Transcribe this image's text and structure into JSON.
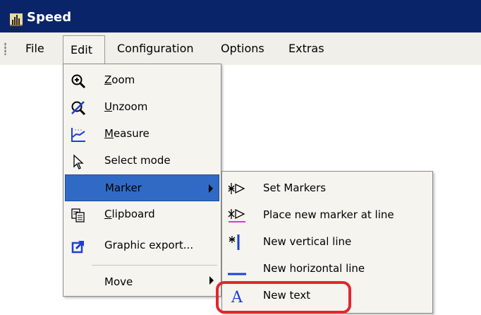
{
  "window": {
    "title": "Speed"
  },
  "menubar": {
    "items": [
      {
        "label": "File"
      },
      {
        "label": "Edit"
      },
      {
        "label": "Configuration"
      },
      {
        "label": "Options"
      },
      {
        "label": "Extras"
      }
    ]
  },
  "edit_menu": {
    "items": [
      {
        "mnemonic": "Z",
        "rest": "oom",
        "icon": "zoom-in-icon"
      },
      {
        "mnemonic": "U",
        "rest": "nzoom",
        "icon": "unzoom-icon"
      },
      {
        "mnemonic": "M",
        "rest": "easure",
        "icon": "measure-icon"
      },
      {
        "label": "Select mode",
        "icon": "cursor-arrow-icon"
      },
      {
        "label": "Marker",
        "has_submenu": true
      },
      {
        "mnemonic": "C",
        "rest": "lipboard",
        "icon": "clipboard-icon"
      },
      {
        "label": "Graphic export...",
        "icon": "export-icon"
      },
      {
        "label": "Move",
        "has_submenu": true
      }
    ]
  },
  "marker_submenu": {
    "items": [
      {
        "label": "Set Markers",
        "icon": "set-markers-icon"
      },
      {
        "label": "Place new marker at line",
        "icon": "place-marker-icon"
      },
      {
        "label": "New vertical line",
        "icon": "vertical-line-icon"
      },
      {
        "label": "New horizontal line",
        "icon": "horizontal-line-icon"
      },
      {
        "label": "New text",
        "icon": "text-a-icon"
      }
    ]
  },
  "colors": {
    "titlebar": "#0a246a",
    "highlight": "#316ac5",
    "annotation_ring": "#e3262e"
  }
}
